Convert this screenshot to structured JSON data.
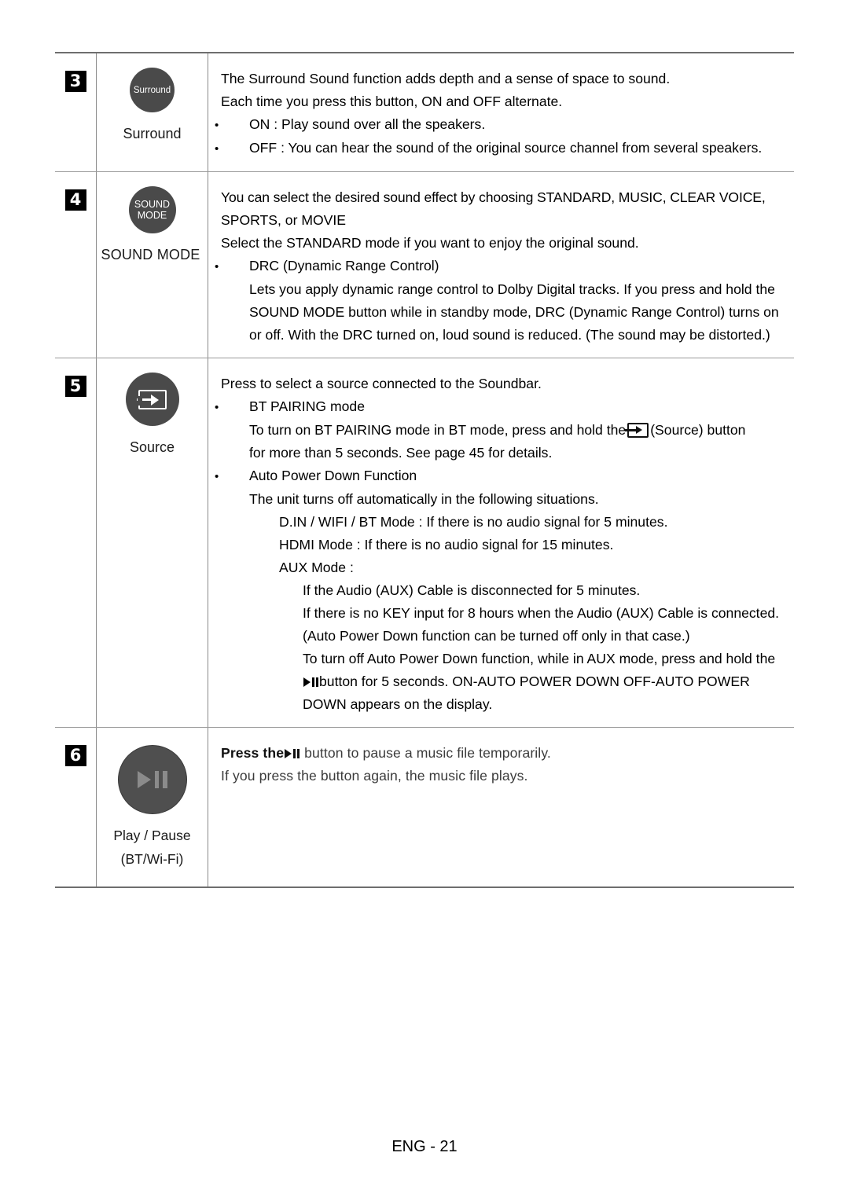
{
  "document": {
    "footer": "ENG - 21"
  },
  "table": {
    "rows": [
      {
        "number": "3",
        "button": {
          "icon_label": "Surround",
          "caption": "Surround"
        },
        "lines": [
          "The Surround Sound function adds depth and a sense of space to sound.",
          "Each time you press this button, ON and OFF alternate.",
          "ON : Play sound over all the speakers.",
          "OFF : You can hear the sound of the original source channel from several speakers."
        ]
      },
      {
        "number": "4",
        "button": {
          "icon_label_line1": "SOUND",
          "icon_label_line2": "MODE",
          "caption": "SOUND MODE"
        },
        "lines": [
          "You can select the desired sound effect by choosing STANDARD, MUSIC, CLEAR VOICE,",
          "SPORTS, or MOVIE",
          "Select the STANDARD mode if you want to enjoy the original sound.",
          "DRC (Dynamic Range Control)",
          "Lets you apply dynamic range control to Dolby Digital tracks. If you press and hold the",
          "SOUND MODE button while in standby mode, DRC (Dynamic Range Control) turns on",
          "or off. With the DRC turned on, loud sound is reduced. (The sound may be distorted.)"
        ]
      },
      {
        "number": "5",
        "button": {
          "icon_name": "source-icon",
          "caption": "Source"
        },
        "lines": [
          "Press to select a source connected to the Soundbar.",
          "BT PAIRING mode",
          "To turn on BT PAIRING mode in BT mode, press and hold the",
          "(Source) button",
          "for more than 5 seconds. See page 45 for details.",
          "Auto Power Down Function",
          "The unit turns off automatically in the following situations.",
          "D.IN / WIFI / BT Mode : If there is no audio signal for 5 minutes.",
          "HDMI Mode : If there is no audio signal for 15 minutes.",
          "AUX Mode :",
          "If the Audio (AUX) Cable is disconnected for 5 minutes.",
          "If there is no KEY input for 8 hours when the Audio (AUX) Cable is connected.",
          "(Auto Power Down function can be turned off only in that case.)",
          "To turn off Auto Power Down function, while in AUX mode, press and hold the",
          "button for 5 seconds. ON-AUTO POWER DOWN  OFF-AUTO POWER",
          "DOWN appears on the display."
        ]
      },
      {
        "number": "6",
        "button": {
          "icon_name": "play-pause-icon",
          "caption_line1": "Play / Pause",
          "caption_line2": "(BT/Wi-Fi)"
        },
        "lines": [
          "Press the",
          "button to pause a music file temporarily.",
          "If you press the button again, the music file plays."
        ]
      }
    ]
  }
}
